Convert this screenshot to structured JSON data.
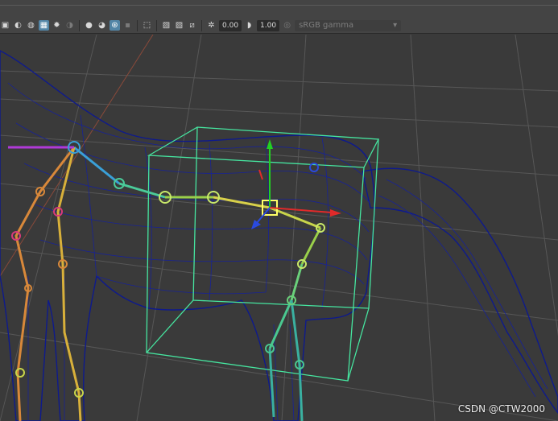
{
  "toolbar": {
    "exposure_value": "0.00",
    "gamma_value": "1.00",
    "color_space": "sRGB gamma"
  },
  "viewport": {
    "watermark": "CSDN @CTW2000",
    "wireframe_color": "#0e1a8c",
    "bounding_box_color": "#46e6a0",
    "grid_color": "#5a5a5a",
    "background_color": "#3a3a3a"
  }
}
